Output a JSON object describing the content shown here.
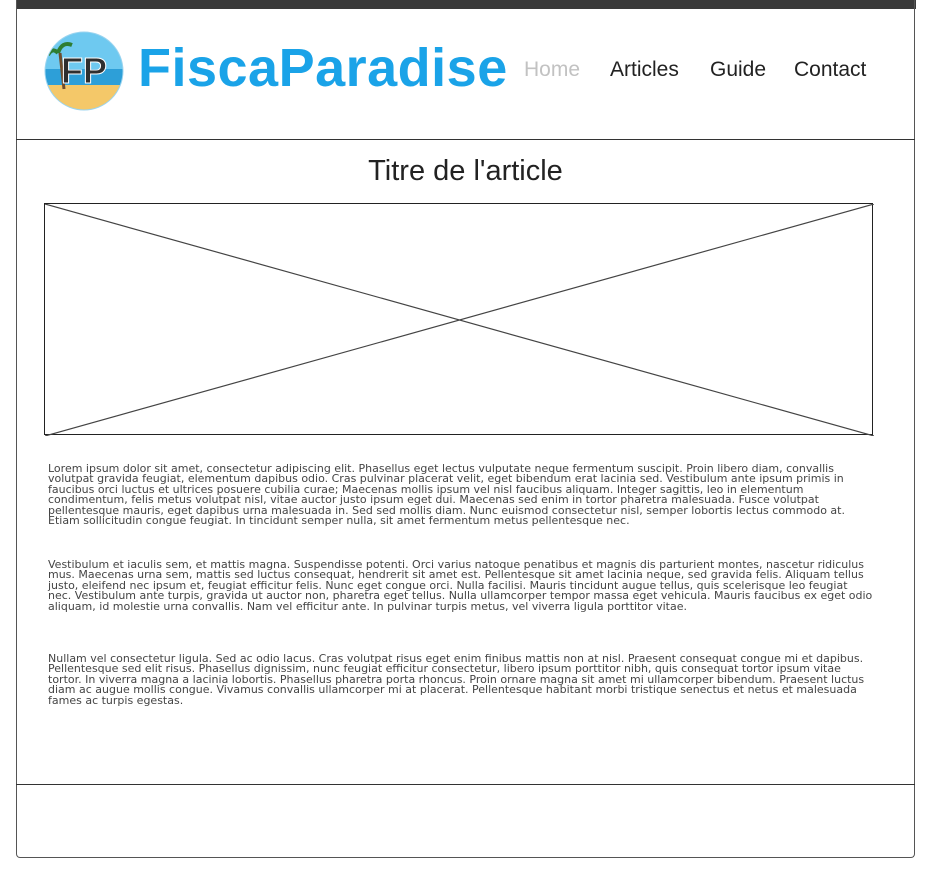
{
  "header": {
    "logo_letters": "FP",
    "brand": "FiscaParadise",
    "nav": [
      "Home",
      "Articles",
      "Guide",
      "Contact"
    ],
    "active_nav": "Home"
  },
  "article": {
    "title": "Titre de l'article",
    "paragraphs": [
      "Lorem ipsum dolor sit amet, consectetur adipiscing elit. Phasellus eget lectus vulputate neque fermentum suscipit. Proin libero diam, convallis volutpat gravida feugiat, elementum dapibus odio. Cras pulvinar placerat velit, eget bibendum erat lacinia sed. Vestibulum ante ipsum primis in faucibus orci luctus et ultrices posuere cubilia curae; Maecenas mollis ipsum vel nisl faucibus aliquam. Integer sagittis, leo in elementum condimentum, felis metus volutpat nisl, vitae auctor justo ipsum eget dui. Maecenas sed enim in tortor pharetra malesuada. Fusce volutpat pellentesque mauris, eget dapibus urna malesuada in. Sed sed mollis diam. Nunc euismod consectetur nisl, semper lobortis lectus commodo at. Etiam sollicitudin congue feugiat. In tincidunt semper nulla, sit amet fermentum metus pellentesque nec.",
      "Vestibulum et iaculis sem, et mattis magna. Suspendisse potenti. Orci varius natoque penatibus et magnis dis parturient montes, nascetur ridiculus mus. Maecenas urna sem, mattis sed luctus consequat, hendrerit sit amet est. Pellentesque sit amet lacinia neque, sed gravida felis. Aliquam tellus justo, eleifend nec ipsum et, feugiat efficitur felis. Nunc eget congue orci. Nulla facilisi. Mauris tincidunt augue tellus, quis scelerisque leo feugiat nec. Vestibulum ante turpis, gravida ut auctor non, pharetra eget tellus. Nulla ullamcorper tempor massa eget vehicula. Mauris faucibus ex eget odio aliquam, id molestie urna convallis. Nam vel efficitur ante. In pulvinar turpis metus, vel viverra ligula porttitor vitae.",
      "Nullam vel consectetur ligula. Sed ac odio lacus. Cras volutpat risus eget enim finibus mattis non at nisl. Praesent consequat congue mi et dapibus. Pellentesque sed elit risus. Phasellus dignissim, nunc feugiat efficitur consectetur, libero ipsum porttitor nibh, quis consequat tortor ipsum vitae tortor. In viverra magna a lacinia lobortis. Phasellus pharetra porta rhoncus. Proin ornare magna sit amet mi ullamcorper bibendum. Praesent luctus diam ac augue mollis congue. Vivamus convallis ullamcorper mi at placerat. Pellentesque habitant morbi tristique senectus et netus et malesuada fames ac turpis egestas."
    ]
  },
  "colors": {
    "brand": "#1aa3e8",
    "nav_active": "#c2c2c2",
    "topbar": "#3a3a3a"
  }
}
